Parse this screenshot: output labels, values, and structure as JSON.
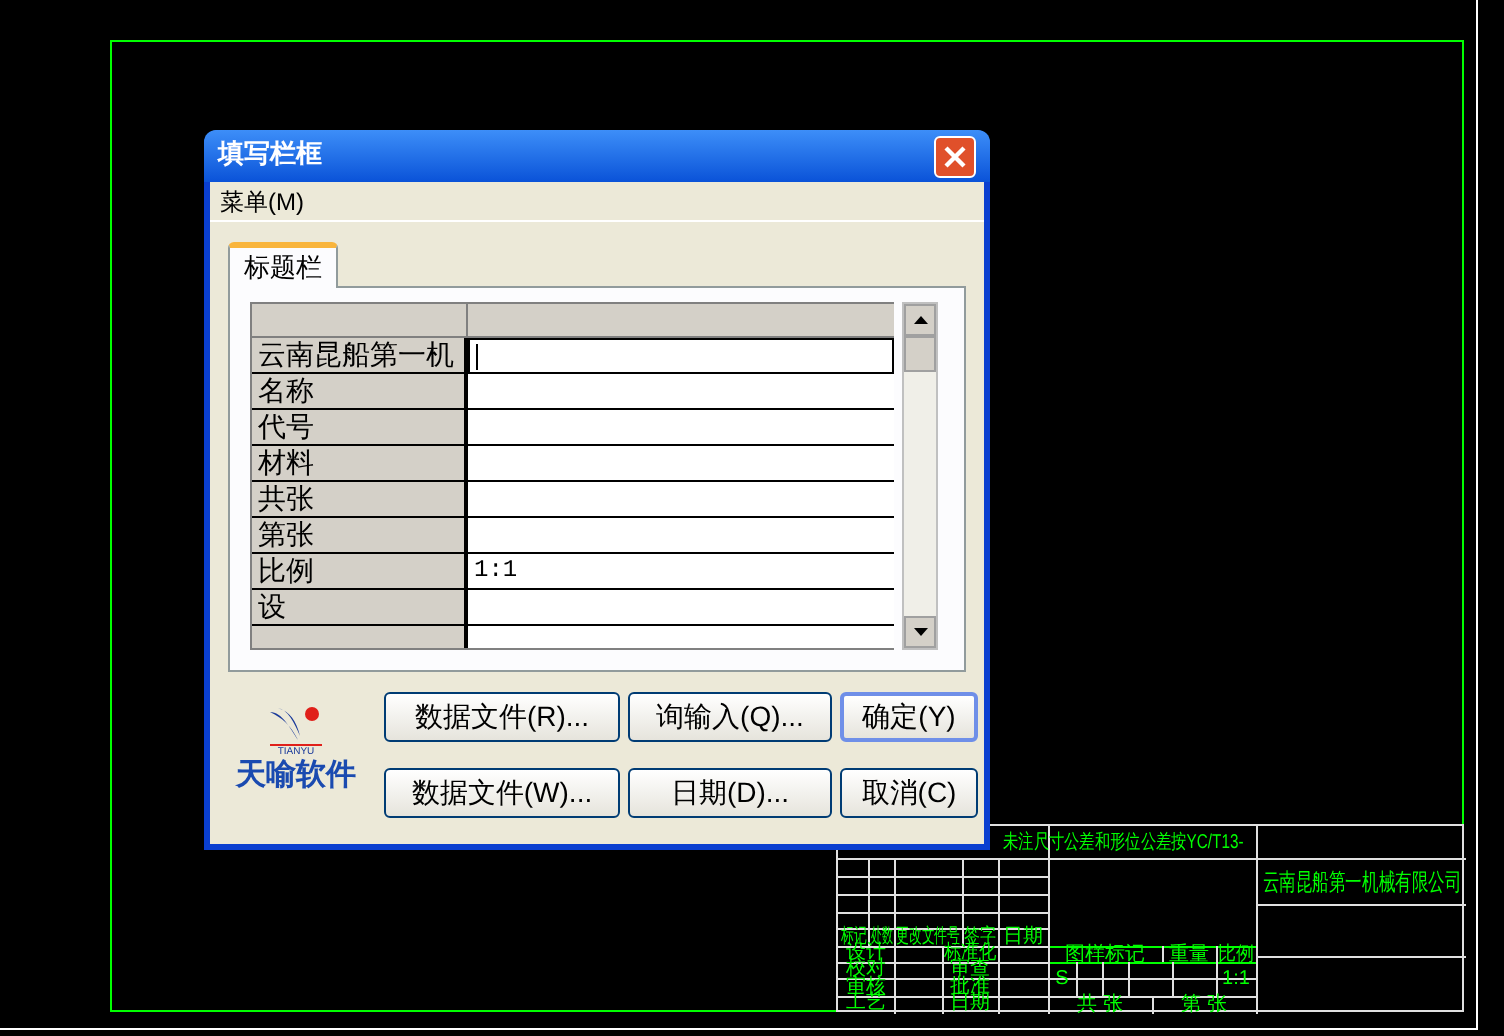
{
  "dialog": {
    "title": "填写栏框",
    "menu": [
      {
        "label": "菜单(M)"
      }
    ],
    "tabs": [
      {
        "label": "标题栏",
        "selected": true
      }
    ],
    "grid": {
      "rows": [
        {
          "label": "云南昆船第一机",
          "value": "",
          "editing": true
        },
        {
          "label": "名称",
          "value": "",
          "editing": false
        },
        {
          "label": "代号",
          "value": "",
          "editing": false
        },
        {
          "label": "材料",
          "value": "",
          "editing": false
        },
        {
          "label": "共张",
          "value": "",
          "editing": false
        },
        {
          "label": "第张",
          "value": "",
          "editing": false
        },
        {
          "label": "比例",
          "value": "1:1",
          "editing": false
        },
        {
          "label": "设",
          "value": "",
          "editing": false
        }
      ]
    },
    "logo": {
      "subtitle": "TIANYU",
      "name": "天喻软件"
    },
    "buttons": [
      {
        "label": "数据文件(R)...",
        "default": false
      },
      {
        "label": "询输入(Q)...",
        "default": false
      },
      {
        "label": "确定(Y)",
        "default": true
      },
      {
        "label": "数据文件(W)...",
        "default": false
      },
      {
        "label": "日期(D)...",
        "default": false
      },
      {
        "label": "取消(C)",
        "default": false
      }
    ]
  },
  "title_block": {
    "note": "未注尺寸公差和形位公差按YC/T13-",
    "company": "云南昆船第一机械有限公司",
    "revision_header": [
      "标记",
      "处数",
      "更改文件号",
      "签字",
      "日期"
    ],
    "approvals": [
      [
        "设计",
        "标准化"
      ],
      [
        "校对",
        "审查"
      ],
      [
        "审核",
        "批准"
      ],
      [
        "工艺",
        "日期"
      ]
    ],
    "drawing_header": [
      "图样标记",
      "重量",
      "比例"
    ],
    "mark": "S",
    "scale": "1:1",
    "sheets": [
      "共 张",
      "第 张"
    ]
  }
}
